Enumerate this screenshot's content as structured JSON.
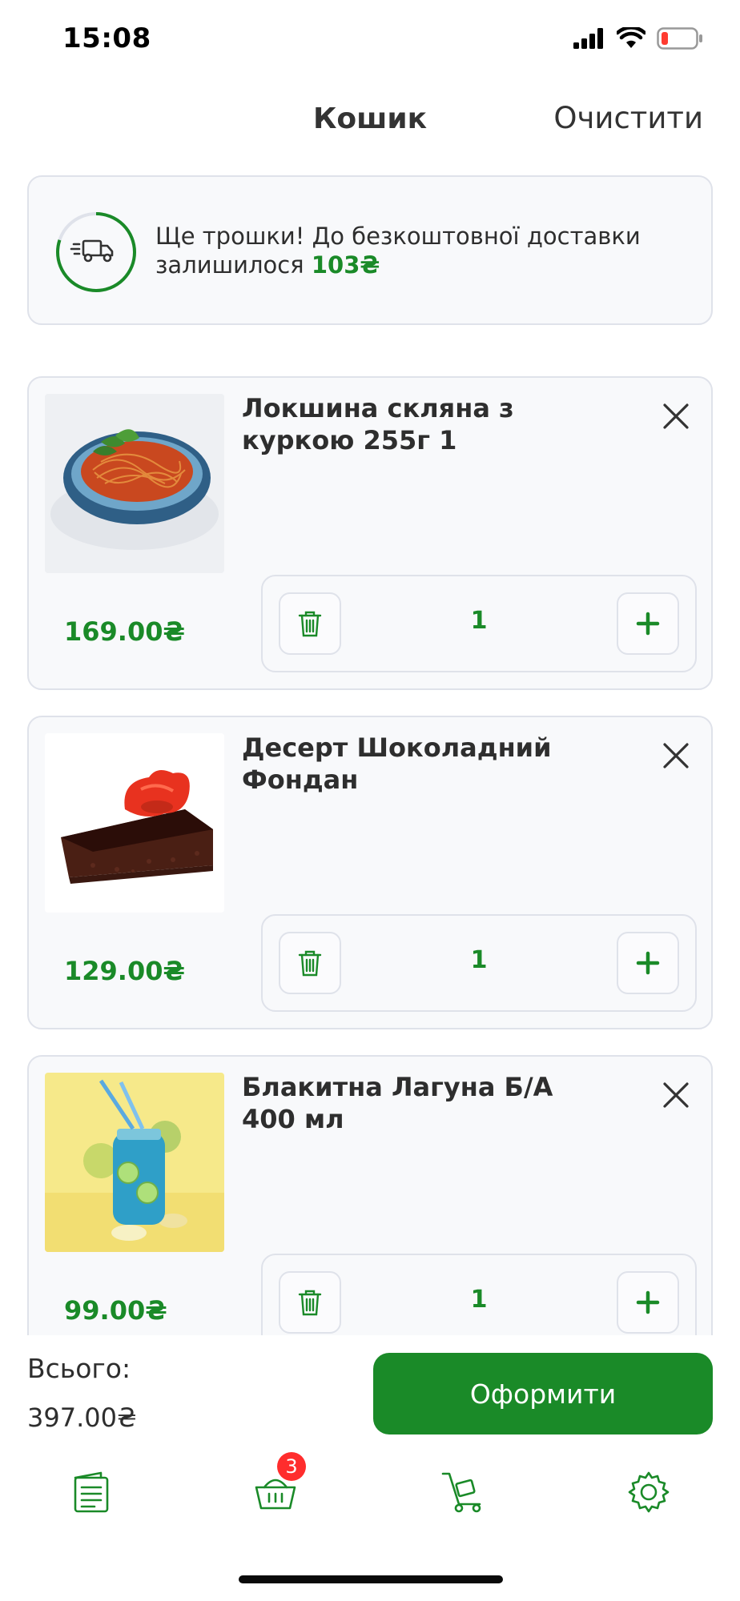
{
  "status_bar": {
    "time": "15:08"
  },
  "header": {
    "title": "Кошик",
    "clear_label": "Очистити"
  },
  "delivery": {
    "text": "Ще трошки! До безкоштовної доставки залишилося",
    "amount": "103₴",
    "progress_fraction": 0.8
  },
  "items": [
    {
      "name": " Локшина скляна з куркою 255г 1",
      "price": "169.00₴",
      "quantity": "1"
    },
    {
      "name": "Десерт Шоколадний Фондан",
      "price": "129.00₴",
      "quantity": "1"
    },
    {
      "name": "Блакитна Лагуна Б/А 400 мл",
      "price": "99.00₴",
      "quantity": "1"
    }
  ],
  "footer": {
    "total_label": "Всього:",
    "total_value": "397.00₴",
    "checkout_label": "Оформити"
  },
  "tab_bar": {
    "tabs": [
      {
        "icon": "menu-list-icon"
      },
      {
        "icon": "basket-icon",
        "badge": "3"
      },
      {
        "icon": "delivery-cart-icon"
      },
      {
        "icon": "settings-gear-icon"
      }
    ]
  },
  "colors": {
    "accent": "#1a8a28",
    "badge": "#ff2d2d",
    "card_bg": "#f8f9fb",
    "card_border": "#dfe2ea"
  }
}
